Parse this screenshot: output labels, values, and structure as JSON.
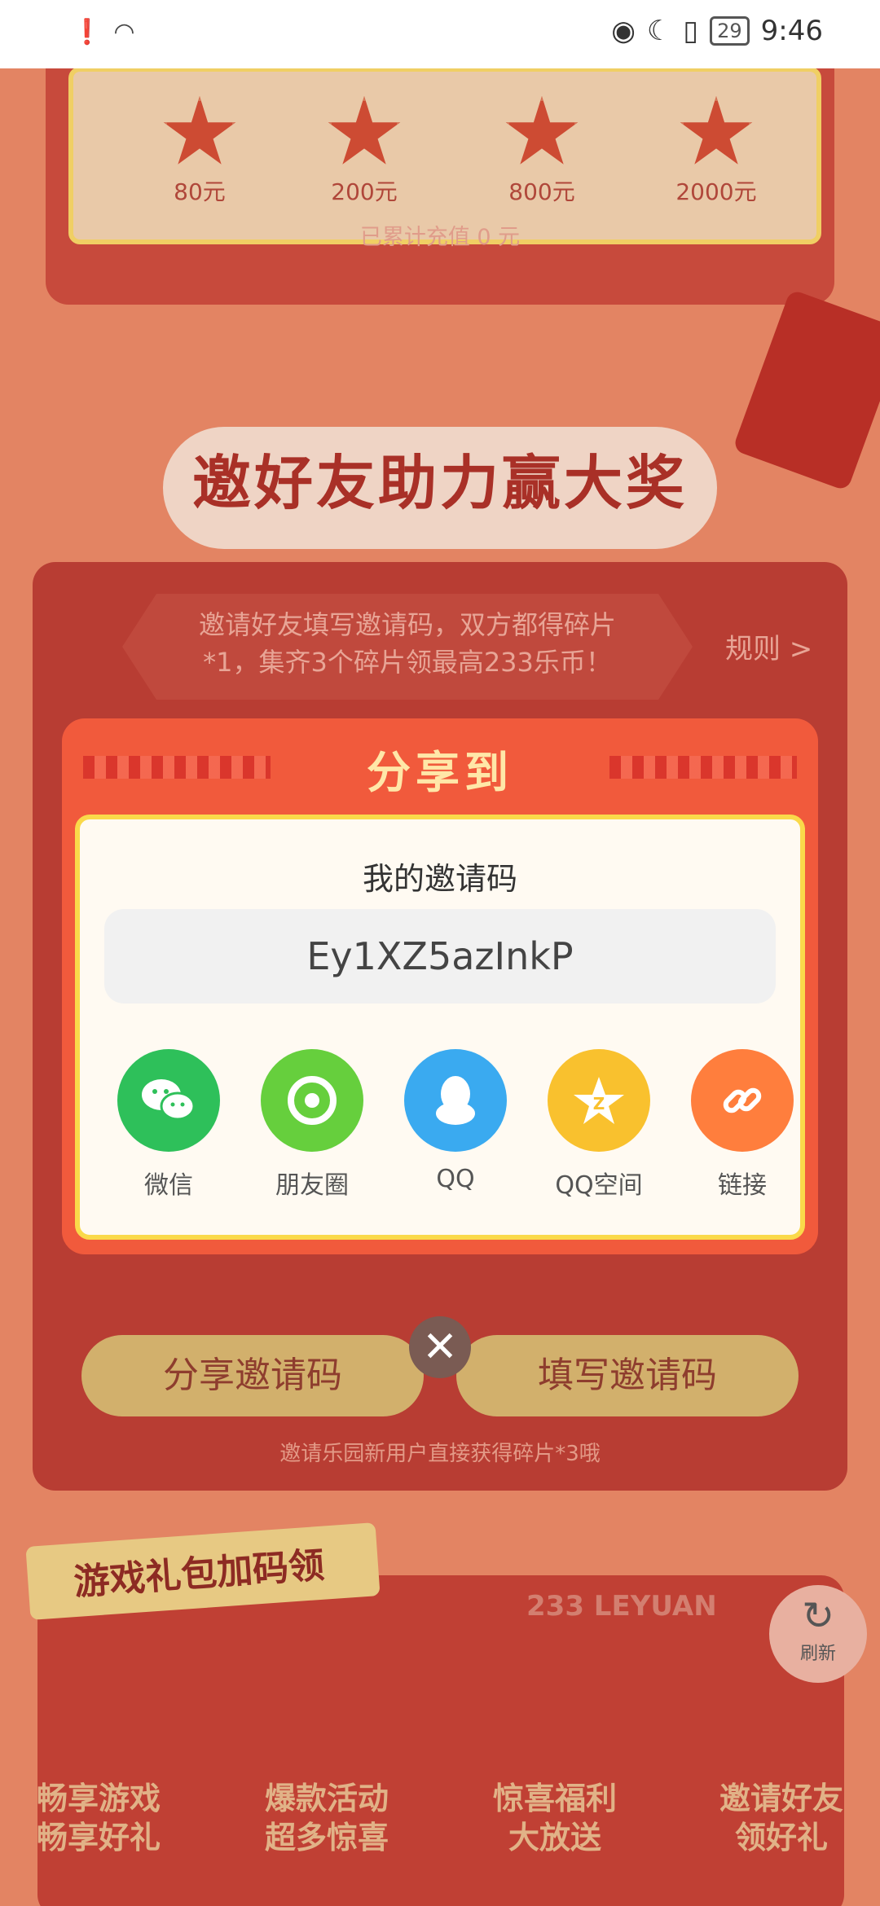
{
  "status_bar": {
    "time": "9:46",
    "battery": "29"
  },
  "recharge": {
    "tiers": [
      "80元",
      "200元",
      "800元",
      "2000元"
    ],
    "total_text": "已累计充值 0 元"
  },
  "invite_section": {
    "title": "邀好友助力赢大奖",
    "hint_line1": "邀请好友填写邀请码，双方都得碎片",
    "hint_line2": "*1，集齐3个碎片领最高233乐币！",
    "rules_label": "规则 >",
    "share_code_button": "分享邀请码",
    "fill_code_button": "填写邀请码",
    "tip": "邀请乐园新用户直接获得碎片*3哦"
  },
  "gift_section": {
    "ribbon_title": "游戏礼包加码领",
    "brand": "233 LEYUAN",
    "promos": [
      {
        "line1": "畅享游戏",
        "line2": "畅享好礼"
      },
      {
        "line1": "爆款活动",
        "line2": "超多惊喜"
      },
      {
        "line1": "惊喜福利",
        "line2": "大放送"
      },
      {
        "line1": "邀请好友",
        "line2": "领好礼"
      }
    ]
  },
  "refresh_label": "刷新",
  "dialog": {
    "title": "分享到",
    "code_label": "我的邀请码",
    "code_value": "Ey1XZ5azInkP",
    "targets": [
      {
        "label": "微信",
        "icon": "wechat-icon",
        "color": "#2ec05a"
      },
      {
        "label": "朋友圈",
        "icon": "moments-icon",
        "color": "#66cf3d"
      },
      {
        "label": "QQ",
        "icon": "qq-icon",
        "color": "#3aaaf0"
      },
      {
        "label": "QQ空间",
        "icon": "qzone-icon",
        "color": "#f9c12e"
      },
      {
        "label": "链接",
        "icon": "link-icon",
        "color": "#ff7e3d"
      }
    ],
    "close_icon": "close-icon"
  }
}
